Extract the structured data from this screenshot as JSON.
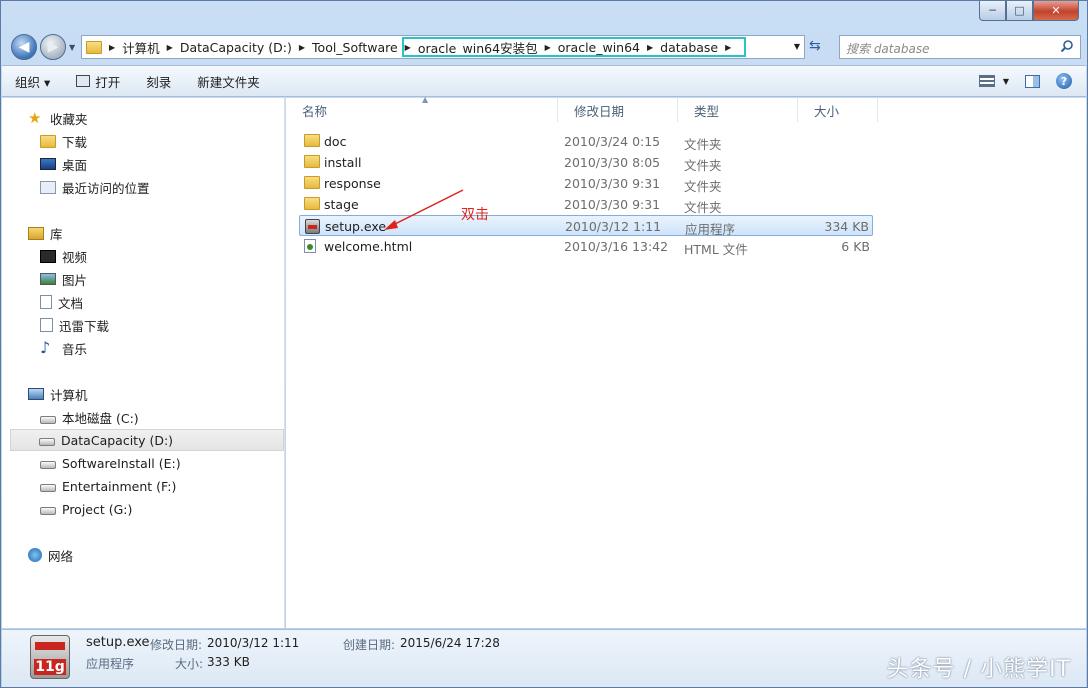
{
  "window": {
    "minimize": "─",
    "maximize": "□",
    "close": "✕"
  },
  "address": {
    "crumbs": [
      "计算机",
      "DataCapacity (D:)",
      "Tool_Software",
      "oracle_win64安装包",
      "oracle_win64",
      "database"
    ]
  },
  "search": {
    "placeholder": "搜索 database"
  },
  "toolbar": {
    "organize": "组织 ▾",
    "open": "打开",
    "burn": "刻录",
    "new_folder": "新建文件夹"
  },
  "nav": {
    "favorites": "收藏夹",
    "downloads": "下载",
    "desktop": "桌面",
    "recent": "最近访问的位置",
    "libraries": "库",
    "video": "视频",
    "pictures": "图片",
    "documents": "文档",
    "thunder": "迅雷下载",
    "music": "音乐",
    "computer": "计算机",
    "drive_c": "本地磁盘 (C:)",
    "drive_d": "DataCapacity (D:)",
    "drive_e": "SoftwareInstall (E:)",
    "drive_f": "Entertainment (F:)",
    "drive_g": "Project (G:)",
    "network": "网络"
  },
  "columns": {
    "name": "名称",
    "date": "修改日期",
    "type": "类型",
    "size": "大小"
  },
  "files": [
    {
      "name": "doc",
      "date": "2010/3/24 0:15",
      "type": "文件夹",
      "size": ""
    },
    {
      "name": "install",
      "date": "2010/3/30 8:05",
      "type": "文件夹",
      "size": ""
    },
    {
      "name": "response",
      "date": "2010/3/30 9:31",
      "type": "文件夹",
      "size": ""
    },
    {
      "name": "stage",
      "date": "2010/3/30 9:31",
      "type": "文件夹",
      "size": ""
    },
    {
      "name": "setup.exe",
      "date": "2010/3/12 1:11",
      "type": "应用程序",
      "size": "334 KB"
    },
    {
      "name": "welcome.html",
      "date": "2010/3/16 13:42",
      "type": "HTML 文件",
      "size": "6 KB"
    }
  ],
  "annotation": "双击",
  "details": {
    "filename": "setup.exe",
    "modified_label": "修改日期:",
    "modified": "2010/3/12 1:11",
    "created_label": "创建日期:",
    "created": "2015/6/24 17:28",
    "type": "应用程序",
    "size_label": "大小:",
    "size": "333 KB",
    "icon_text": "11g"
  },
  "watermark": "头条号 / 小熊学IT"
}
